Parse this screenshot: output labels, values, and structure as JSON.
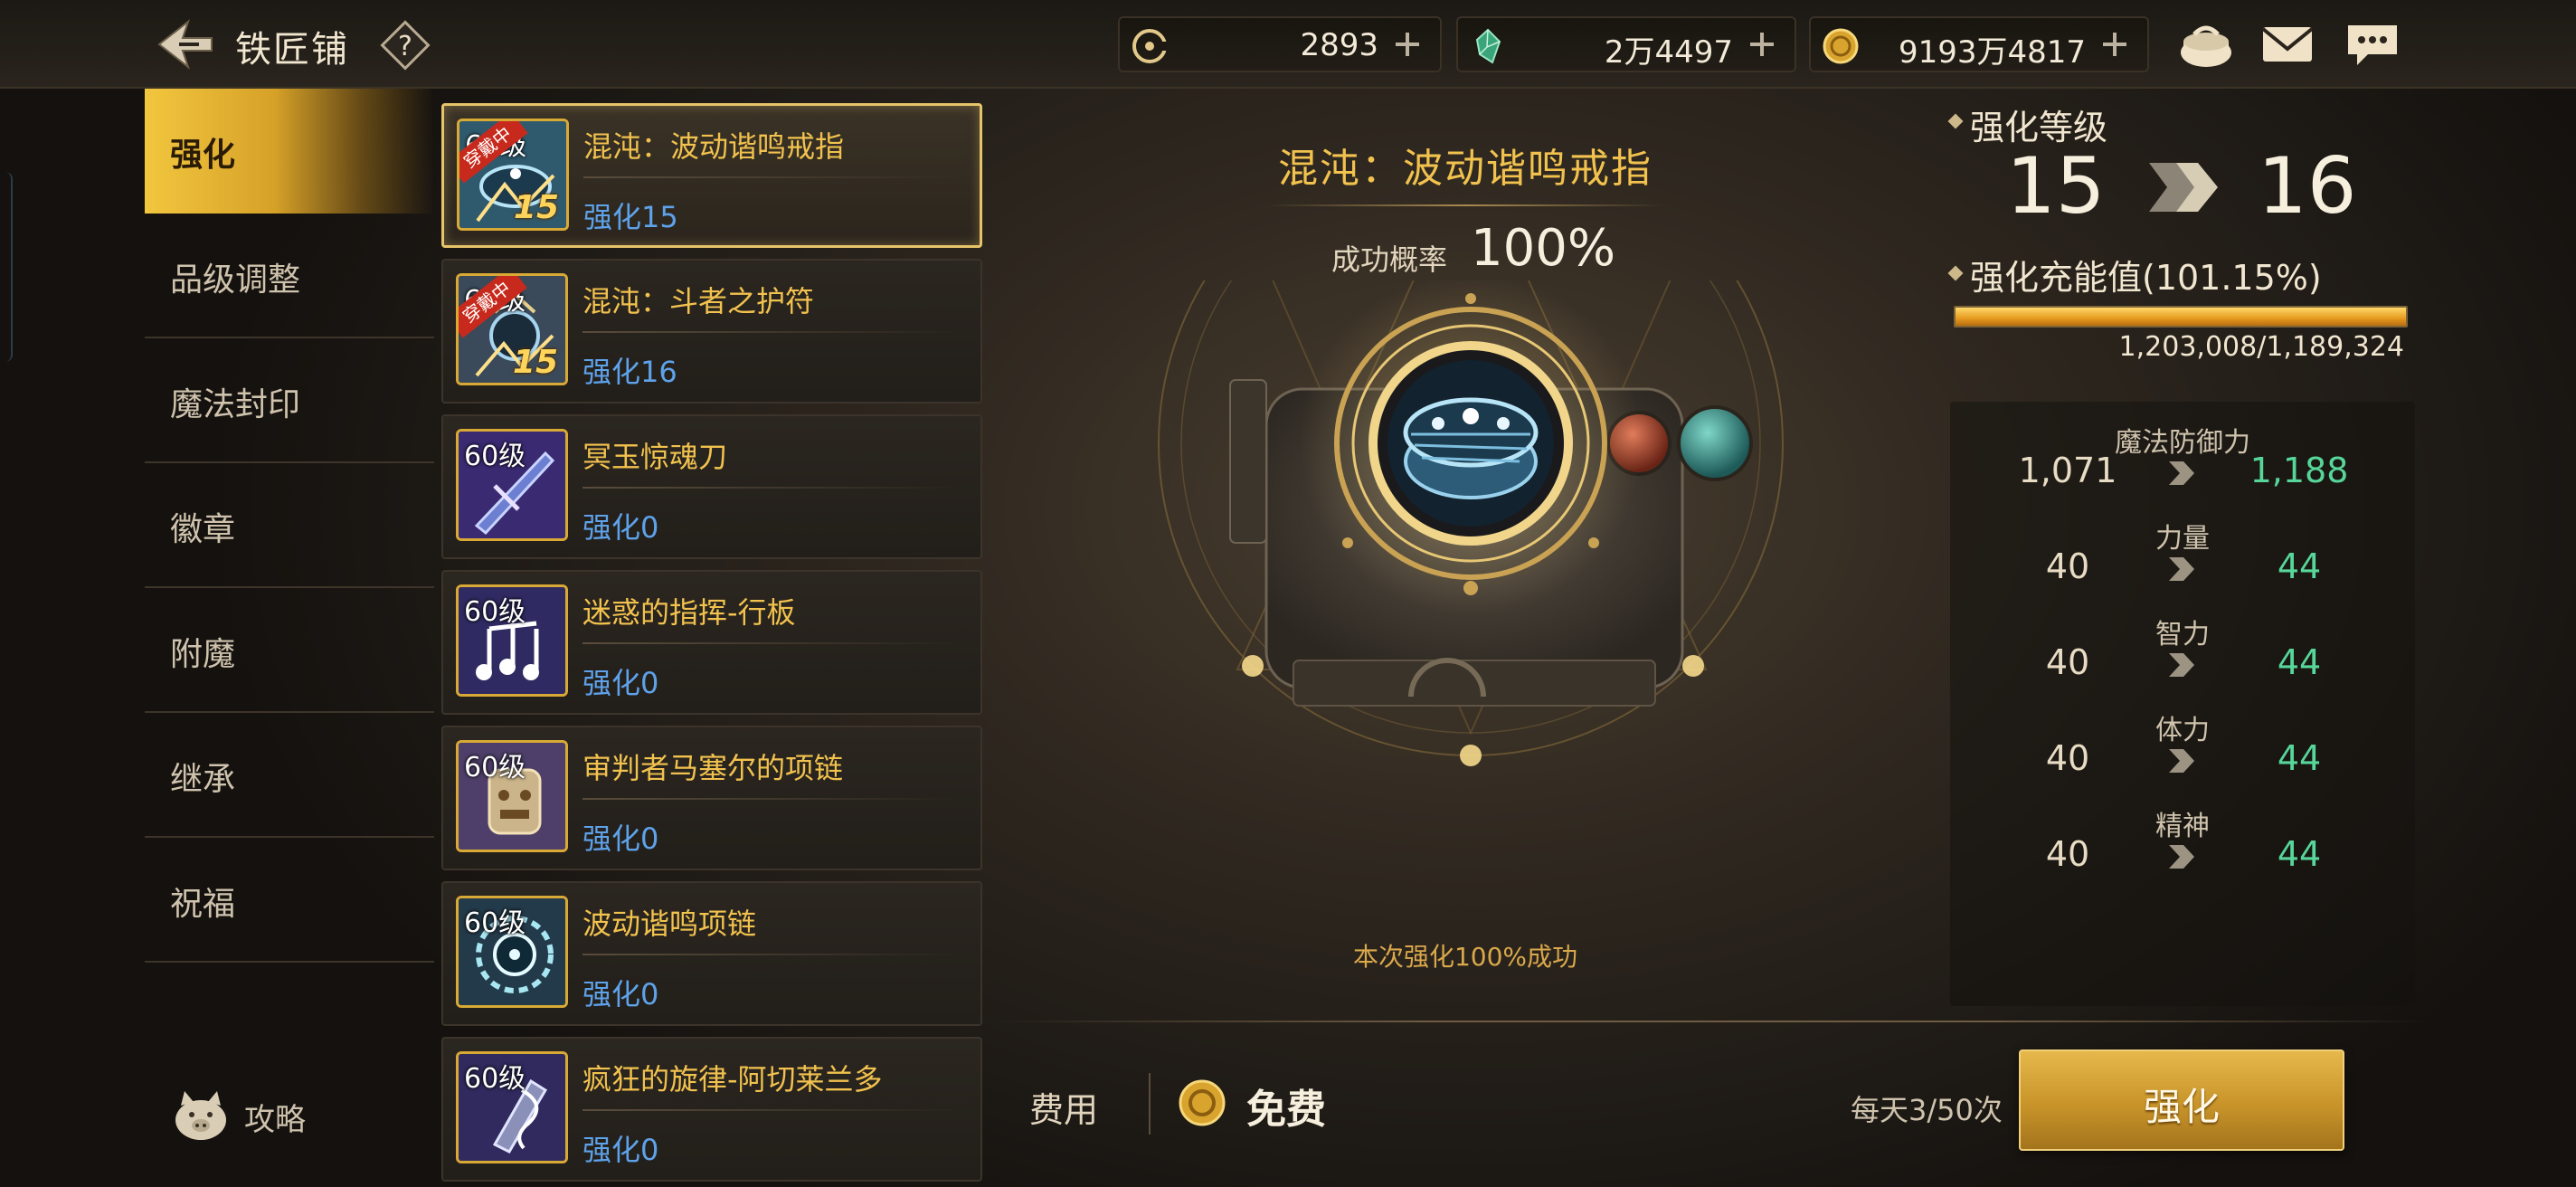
{
  "header": {
    "title": "铁匠铺",
    "currencies": [
      {
        "icon": "c-token-icon",
        "value": "2893"
      },
      {
        "icon": "green-crystal-icon",
        "value": "2万4497"
      },
      {
        "icon": "gold-coin-icon",
        "value": "9193万4817"
      }
    ],
    "icons": [
      "coin-purse-icon",
      "mail-icon",
      "chat-icon"
    ]
  },
  "nav": {
    "items": [
      "强化",
      "品级调整",
      "魔法封印",
      "徽章",
      "附魔",
      "继承",
      "祝福"
    ],
    "active_index": 0,
    "guide_label": "攻略"
  },
  "items": [
    {
      "level": "60级",
      "name": "混沌：波动谐鸣戒指",
      "enhance": "强化15",
      "badge": "穿戴中",
      "enh_num": "15",
      "art": "ring"
    },
    {
      "level": "60级",
      "name": "混沌：斗者之护符",
      "enhance": "强化16",
      "badge": "穿戴中",
      "enh_num": "15",
      "art": "amulet"
    },
    {
      "level": "60级",
      "name": "冥玉惊魂刀",
      "enhance": "强化0",
      "badge": "",
      "enh_num": "",
      "art": "blade"
    },
    {
      "level": "60级",
      "name": "迷惑的指挥-行板",
      "enhance": "强化0",
      "badge": "",
      "enh_num": "",
      "art": "music"
    },
    {
      "level": "60级",
      "name": "审判者马塞尔的项链",
      "enhance": "强化0",
      "badge": "",
      "enh_num": "",
      "art": "necklace"
    },
    {
      "level": "60级",
      "name": "波动谐鸣项链",
      "enhance": "强化0",
      "badge": "",
      "enh_num": "",
      "art": "gear"
    },
    {
      "level": "60级",
      "name": "疯狂的旋律-阿切莱兰多",
      "enhance": "强化0",
      "badge": "",
      "enh_num": "",
      "art": "clef"
    }
  ],
  "selected_item_index": 0,
  "forge": {
    "item_name": "混沌：波动谐鸣戒指",
    "success_label": "成功概率",
    "success_value": "100%",
    "result_note": "本次强化100%成功"
  },
  "upgrade": {
    "level_label": "强化等级",
    "level_from": "15",
    "level_to": "16",
    "charge_label": "强化充能值(101.15%)",
    "charge_fraction": 1.0,
    "charge_numbers": "1,203,008/1,189,324"
  },
  "stats": [
    {
      "name": "魔法防御力",
      "old": "1,071",
      "new": "1,188"
    },
    {
      "name": "力量",
      "old": "40",
      "new": "44"
    },
    {
      "name": "智力",
      "old": "40",
      "new": "44"
    },
    {
      "name": "体力",
      "old": "40",
      "new": "44"
    },
    {
      "name": "精神",
      "old": "40",
      "new": "44"
    }
  ],
  "footer": {
    "cost_label": "费用",
    "cost_value": "免费",
    "daily_count": "每天3/50次",
    "enhance_button": "强化"
  },
  "colors": {
    "accent_gold": "#e6b84b",
    "item_name": "#f2c24e",
    "enhance_blue": "#5ea2ea",
    "stat_up_green": "#57d69a"
  }
}
